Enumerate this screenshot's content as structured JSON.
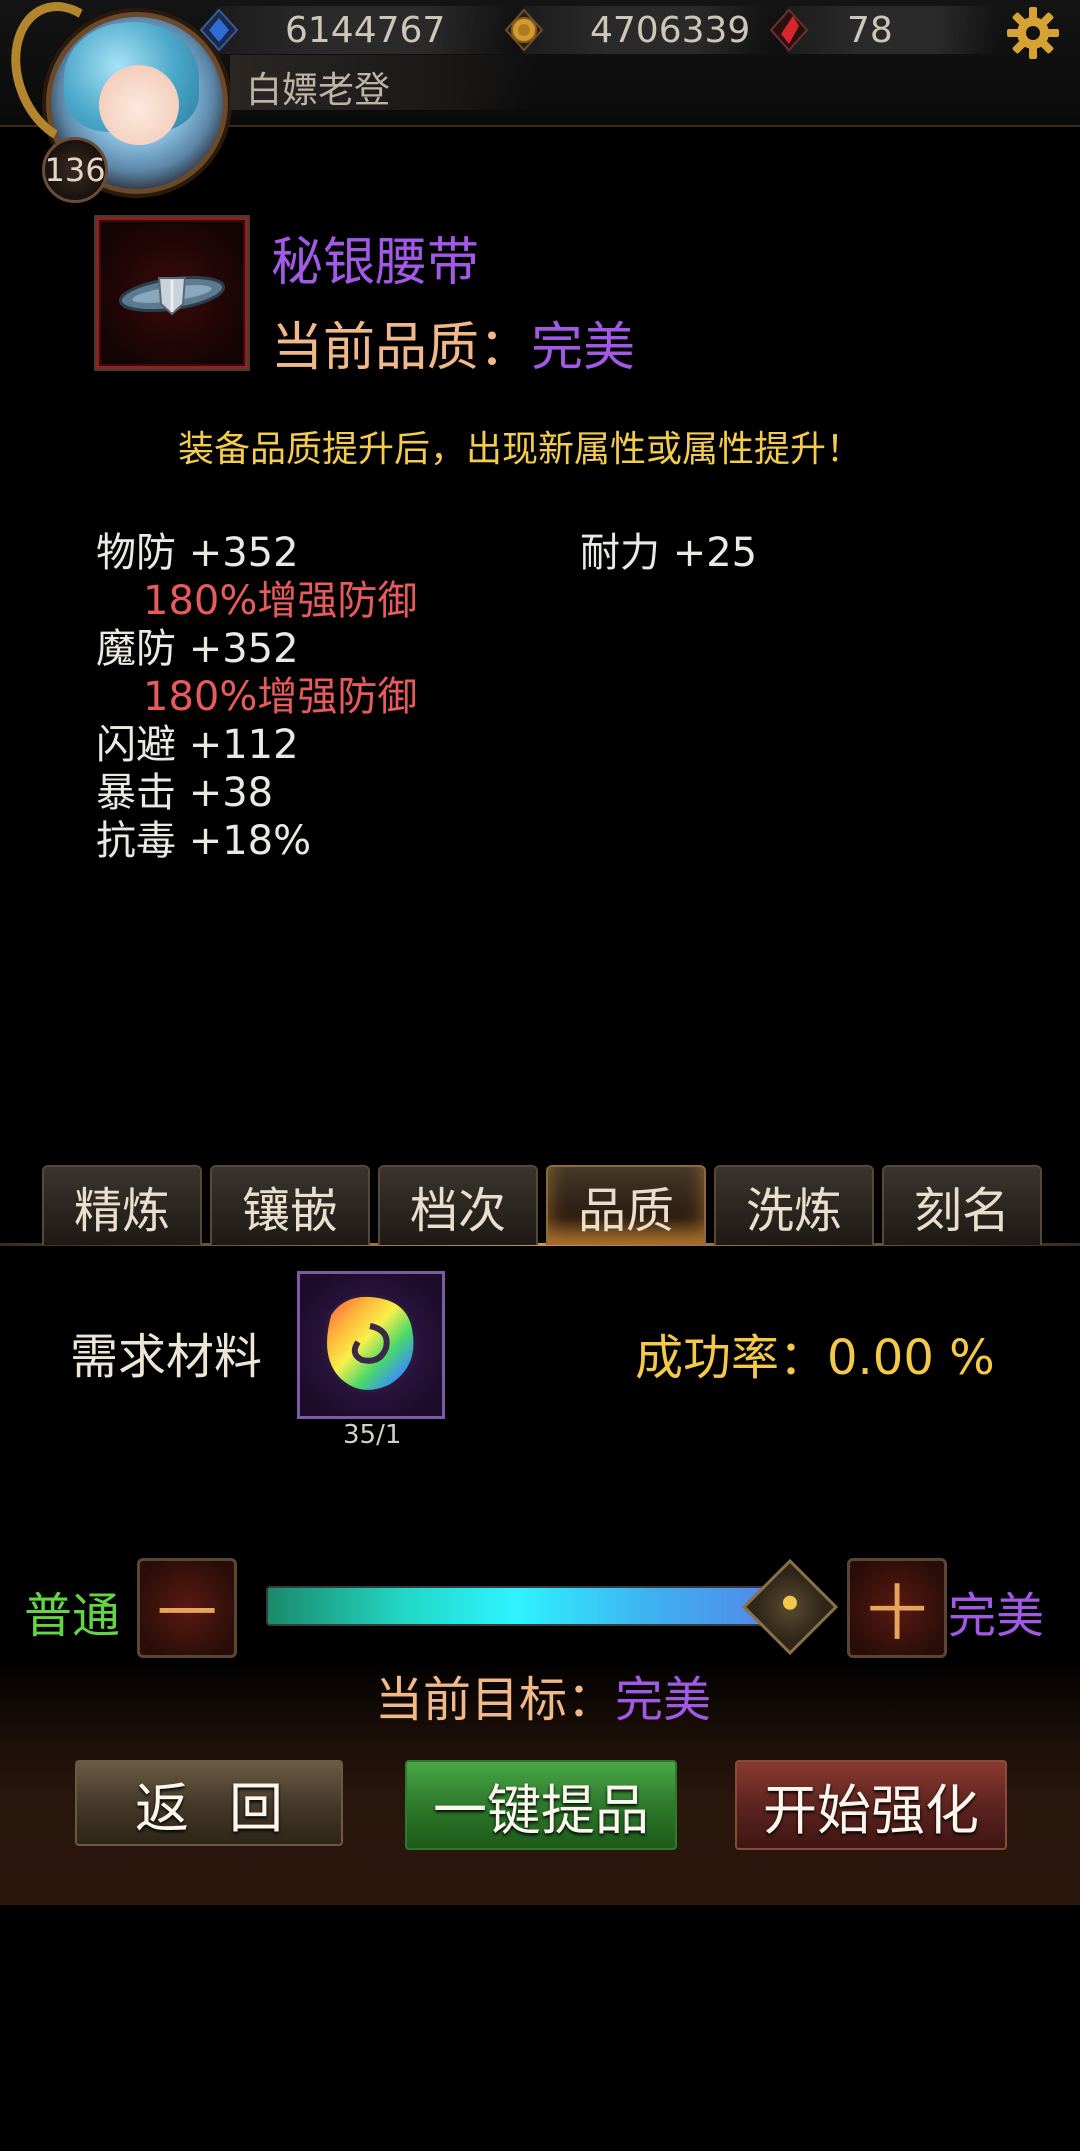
{
  "header": {
    "level": "136",
    "player_name": "白嫖老登",
    "resources": [
      {
        "icon": "blue-gem-icon",
        "value": "6144767"
      },
      {
        "icon": "gold-coin-icon",
        "value": "4706339"
      },
      {
        "icon": "red-crystal-icon",
        "value": "78"
      }
    ],
    "settings_icon": "gear-icon"
  },
  "item": {
    "icon": "belt-icon",
    "name": "秘银腰带",
    "quality_label": "当前品质：",
    "quality_value": "完美"
  },
  "notice": "装备品质提升后，出现新属性或属性提升！",
  "attributes": {
    "left": [
      {
        "text": "物防 +352",
        "kind": "base"
      },
      {
        "text": "180%增强防御",
        "kind": "bonus"
      },
      {
        "text": "魔防 +352",
        "kind": "base"
      },
      {
        "text": "180%增强防御",
        "kind": "bonus"
      },
      {
        "text": "闪避 +112",
        "kind": "base"
      },
      {
        "text": "暴击 +38",
        "kind": "base"
      },
      {
        "text": "抗毒 +18%",
        "kind": "base"
      }
    ],
    "right": [
      {
        "text": "耐力 +25",
        "kind": "base"
      }
    ]
  },
  "tabs": [
    "精炼",
    "镶嵌",
    "档次",
    "品质",
    "洗炼",
    "刻名"
  ],
  "active_tab": "品质",
  "material": {
    "label": "需求材料",
    "icon": "rainbow-stone-icon",
    "count": "35/1",
    "success_rate_label": "成功率：0.00 %"
  },
  "slider": {
    "min_label": "普通",
    "max_label": "完美",
    "minus": "一",
    "plus": "十",
    "level": 1.0
  },
  "target": {
    "label": "当前目标：",
    "value": "完美"
  },
  "buttons": {
    "back": "返回",
    "one_key": "一键提品",
    "start": "开始强化"
  }
}
